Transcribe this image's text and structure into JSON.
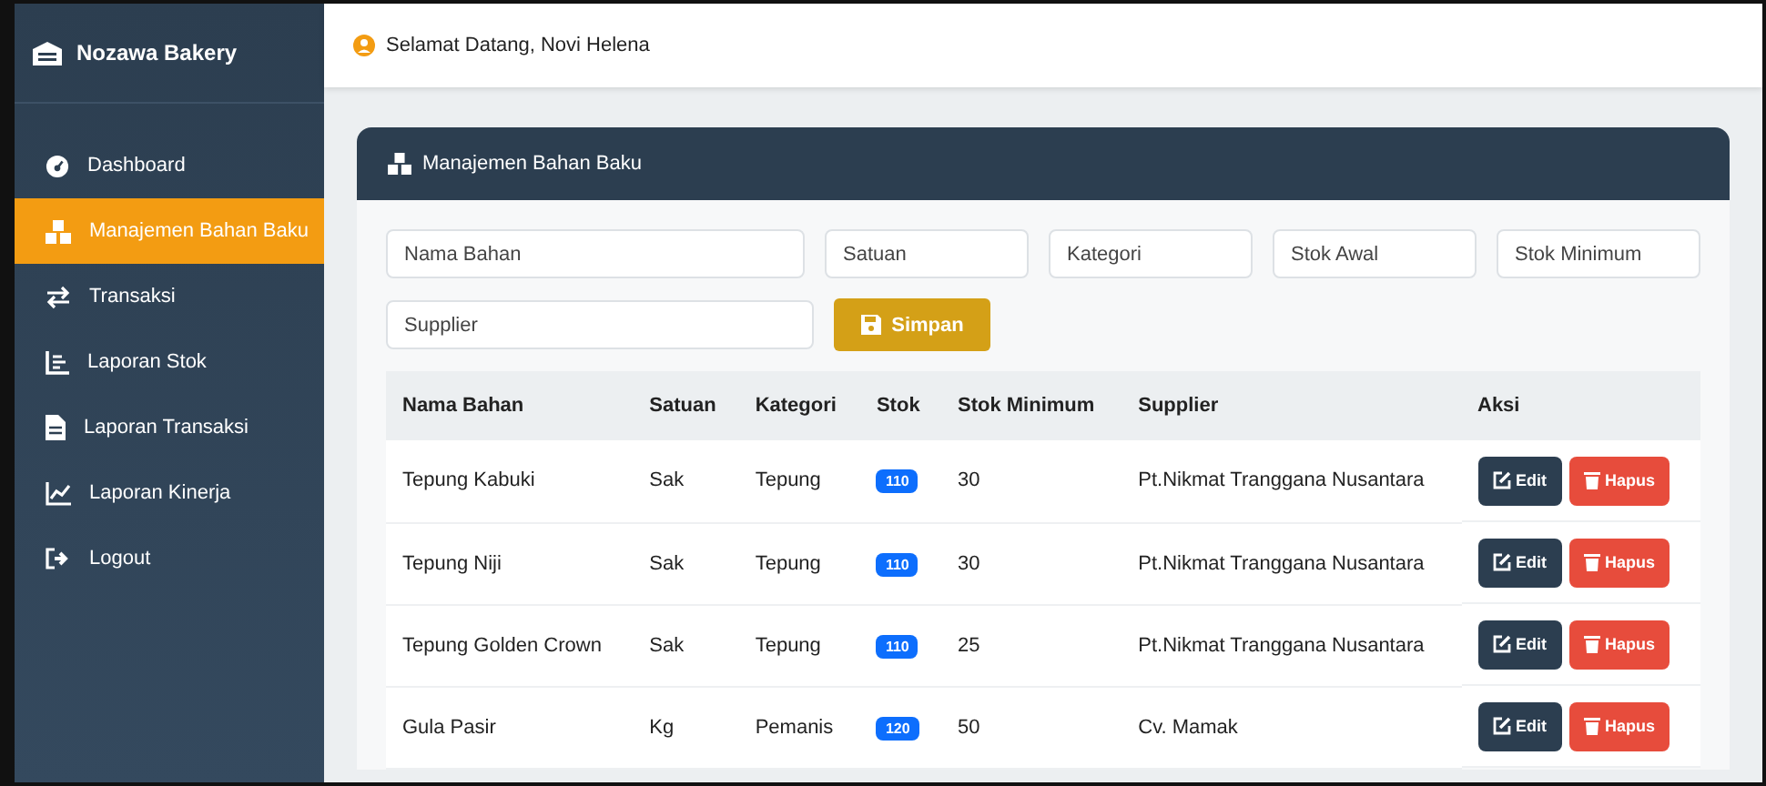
{
  "sidebar": {
    "brand": "Nozawa Bakery",
    "items": [
      {
        "label": "Dashboard",
        "selected": false
      },
      {
        "label": "Manajemen Bahan Baku",
        "selected": true
      },
      {
        "label": "Transaksi",
        "selected": false
      },
      {
        "label": "Laporan Stok",
        "selected": false
      },
      {
        "label": "Laporan Transaksi",
        "selected": false
      },
      {
        "label": "Laporan Kinerja",
        "selected": false
      },
      {
        "label": "Logout",
        "selected": false
      }
    ]
  },
  "topbar": {
    "greeting": "Selamat Datang, Novi Helena"
  },
  "card": {
    "title": "Manajemen Bahan Baku",
    "fields": [
      {
        "placeholder": "Nama Bahan"
      },
      {
        "placeholder": "Satuan"
      },
      {
        "placeholder": "Kategori"
      },
      {
        "placeholder": "Stok Awal"
      },
      {
        "placeholder": "Stok Minimum"
      },
      {
        "placeholder": "Supplier"
      }
    ],
    "save_button": "Simpan",
    "table": {
      "columns": [
        "Nama Bahan",
        "Satuan",
        "Kategori",
        "Stok",
        "Stok Minimum",
        "Supplier",
        "Aksi"
      ],
      "rows": [
        {
          "nama": "Tepung Kabuki",
          "satuan": "Sak",
          "kategori": "Tepung",
          "stok": "110",
          "stok_minimum": "30",
          "supplier": "Pt.Nikmat Tranggana Nusantara",
          "edit": "Edit",
          "hapus": "Hapus"
        },
        {
          "nama": "Tepung Niji",
          "satuan": "Sak",
          "kategori": "Tepung",
          "stok": "110",
          "stok_minimum": "30",
          "supplier": "Pt.Nikmat Tranggana Nusantara",
          "edit": "Edit",
          "hapus": "Hapus"
        },
        {
          "nama": "Tepung Golden Crown",
          "satuan": "Sak",
          "kategori": "Tepung",
          "stok": "110",
          "stok_minimum": "25",
          "supplier": "Pt.Nikmat Tranggana Nusantara",
          "edit": "Edit",
          "hapus": "Hapus"
        },
        {
          "nama": "Gula Pasir",
          "satuan": "Kg",
          "kategori": "Pemanis",
          "stok": "120",
          "stok_minimum": "50",
          "supplier": "Cv. Mamak",
          "edit": "Edit",
          "hapus": "Hapus"
        }
      ]
    }
  }
}
